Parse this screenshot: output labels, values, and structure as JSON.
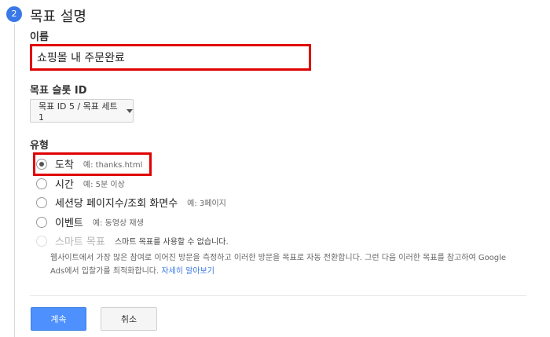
{
  "step": {
    "number": "2",
    "title": "목표 설명"
  },
  "name": {
    "label": "이름",
    "value": "쇼핑몰 내 주문완료"
  },
  "slot": {
    "label": "목표 슬롯 ID",
    "selected": "목표 ID 5 / 목표 세트 1"
  },
  "type": {
    "label": "유형",
    "options": [
      {
        "label": "도착",
        "example": "예: thanks.html",
        "selected": true
      },
      {
        "label": "시간",
        "example": "예: 5분 이상"
      },
      {
        "label": "세션당 페이지수/조회 화면수",
        "example": "예: 3페이지"
      },
      {
        "label": "이벤트",
        "example": "예: 동영상 재생"
      },
      {
        "label": "스마트 목표",
        "example": "스마트 목표를 사용할 수 없습니다.",
        "disabled": true
      }
    ],
    "smart_desc": "웹사이트에서 가장 많은 참여로 이어진 방문을 측정하고 이러한 방문을 목표로 자동 전환합니다. 그런 다음 이러한 목표를 참고하여 Google Ads에서 입찰가를 최적화합니다.",
    "learn_more": "자세히 알아보기"
  },
  "buttons": {
    "continue": "계속",
    "cancel": "취소"
  },
  "colors": {
    "accent": "#3b78e7",
    "highlight": "#e00000",
    "primary_button": "#4d90fe"
  }
}
